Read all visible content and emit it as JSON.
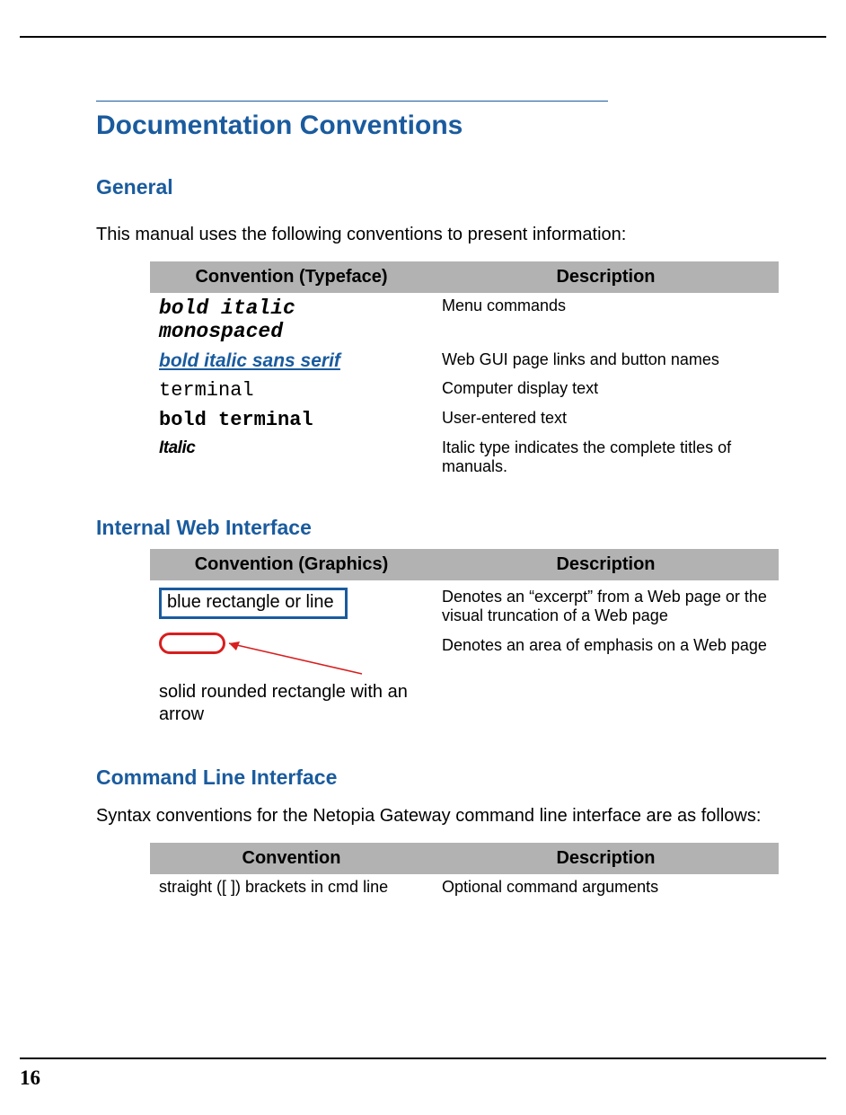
{
  "page_number": "16",
  "title": "Documentation Conventions",
  "general": {
    "heading": "General",
    "intro": "This manual uses the following conventions to present information:",
    "header_left": "Convention (Typeface)",
    "header_right": "Description",
    "rows": {
      "r0": {
        "left": "bold italic monospaced",
        "right": "Menu commands"
      },
      "r1": {
        "left": "bold italic sans serif",
        "right": "Web GUI page links and button names"
      },
      "r2": {
        "left": "terminal",
        "right": "Computer display text"
      },
      "r3": {
        "left": "bold terminal",
        "right": "User-entered text"
      },
      "r4": {
        "left": "Italic",
        "right": "Italic type indicates the complete titles of manuals."
      }
    }
  },
  "iwi": {
    "heading": "Internal Web Interface",
    "header_left": "Convention (Graphics)",
    "header_right": "Description",
    "rows": {
      "r0": {
        "left": "blue rectangle or line",
        "right": "Denotes an “excerpt” from a Web page or the visual truncation of a Web page"
      },
      "r1": {
        "caption": "solid rounded rectangle with an arrow",
        "right": "Denotes an area of emphasis on a Web page"
      }
    }
  },
  "cli": {
    "heading": "Command Line Interface",
    "intro": "Syntax conventions for the Netopia Gateway command line interface are as follows:",
    "header_left": "Convention",
    "header_right": "Description",
    "rows": {
      "r0": {
        "left": "straight ([ ]) brackets in cmd line",
        "right": "Optional command arguments"
      }
    }
  }
}
